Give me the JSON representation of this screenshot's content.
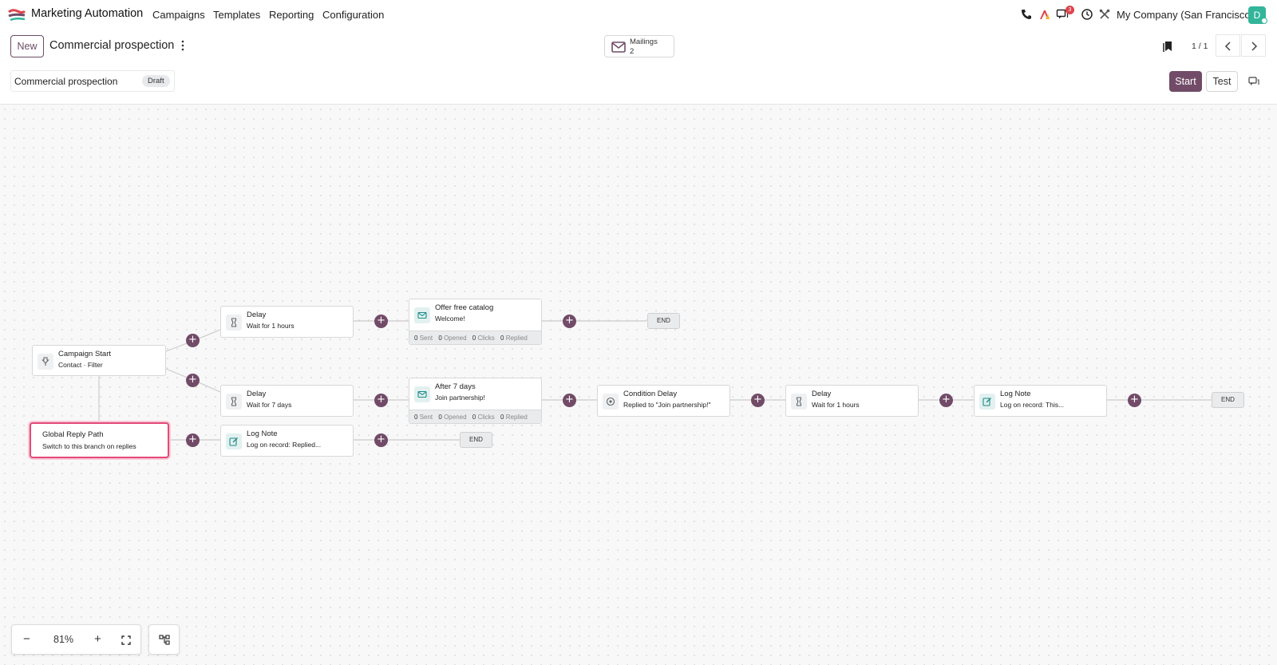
{
  "app": {
    "name": "Marketing Automation"
  },
  "menu": [
    "Campaigns",
    "Templates",
    "Reporting",
    "Configuration"
  ],
  "systray": {
    "messages_badge": "3",
    "company": "My Company (San Francisco)",
    "avatar_initial": "D"
  },
  "control": {
    "new_label": "New",
    "record_title": "Commercial prospection",
    "mailings": {
      "label": "Mailings",
      "count": "2"
    },
    "pager": "1 / 1",
    "name_value": "Commercial prospection",
    "status": "Draft",
    "start_label": "Start",
    "test_label": "Test"
  },
  "workflow": {
    "start": {
      "title": "Campaign Start",
      "subtitle": "Contact · Filter"
    },
    "global_reply": {
      "title": "Global Reply Path",
      "subtitle": "Switch to this branch on replies"
    },
    "delay1": {
      "title": "Delay",
      "subtitle": "Wait for 1 hours"
    },
    "offer": {
      "title": "Offer free catalog",
      "subtitle": "Welcome!",
      "sent": "0",
      "opened": "0",
      "clicks": "0",
      "replied": "0"
    },
    "delay2": {
      "title": "Delay",
      "subtitle": "Wait for 7 days"
    },
    "after7": {
      "title": "After 7 days",
      "subtitle": "Join partnership!",
      "sent": "0",
      "opened": "0",
      "clicks": "0",
      "replied": "0"
    },
    "condition": {
      "title": "Condition Delay",
      "subtitle": "Replied to \"Join partnership!\""
    },
    "delay3": {
      "title": "Delay",
      "subtitle": "Wait for 1 hours"
    },
    "lognote1": {
      "title": "Log Note",
      "subtitle": "Log on record: This..."
    },
    "lognote2": {
      "title": "Log Note",
      "subtitle": "Log on record: Replied..."
    },
    "end_label": "END",
    "stat_labels": {
      "sent": "Sent",
      "opened": "Opened",
      "clicks": "Clicks",
      "replied": "Replied"
    },
    "plus": "+"
  },
  "zoom": {
    "value": "81%",
    "minus": "−",
    "plus": "+"
  }
}
